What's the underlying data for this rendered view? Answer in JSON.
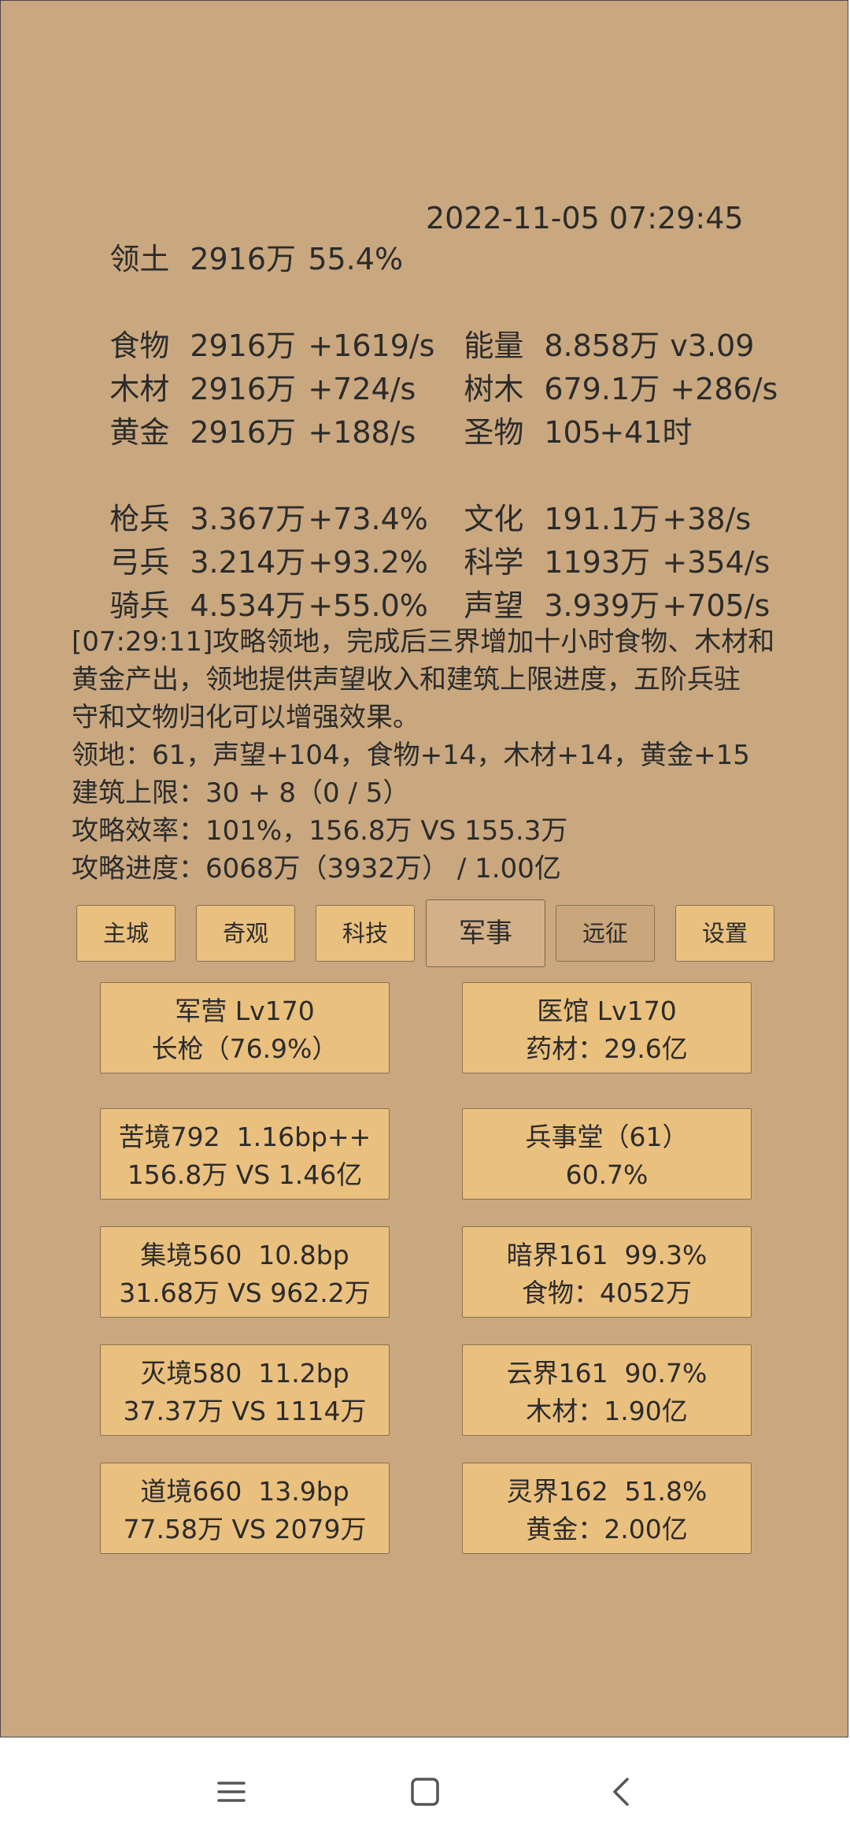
{
  "status": {
    "territory": {
      "label": "领土",
      "value": "2916万",
      "extra": "55.4%"
    },
    "datetime": "2022-11-05 07:29:45"
  },
  "resources_left": [
    {
      "label": "食物",
      "value": "2916万",
      "rate": "+1619/s"
    },
    {
      "label": "木材",
      "value": "2916万",
      "rate": "+724/s"
    },
    {
      "label": "黄金",
      "value": "2916万",
      "rate": "+188/s"
    }
  ],
  "resources_right": [
    {
      "label": "能量",
      "value": "8.858万",
      "rate": "v3.09"
    },
    {
      "label": "树木",
      "value": "679.1万",
      "rate": "+286/s"
    },
    {
      "label": "圣物",
      "value": "105",
      "rate": "+41时"
    }
  ],
  "troops_left": [
    {
      "label": "枪兵",
      "value": "3.367万",
      "rate": "+73.4%"
    },
    {
      "label": "弓兵",
      "value": "3.214万",
      "rate": "+93.2%"
    },
    {
      "label": "骑兵",
      "value": "4.534万",
      "rate": "+55.0%"
    }
  ],
  "troops_right": [
    {
      "label": "文化",
      "value": "191.1万",
      "rate": "+38/s"
    },
    {
      "label": "科学",
      "value": "1193万",
      "rate": "+354/s"
    },
    {
      "label": "声望",
      "value": "3.939万",
      "rate": "+705/s"
    }
  ],
  "log": {
    "lines": [
      "[07:29:11]攻略领地，完成后三界增加十小时食物、木材和",
      "黄金产出，领地提供声望收入和建筑上限进度，五阶兵驻",
      "守和文物归化可以增强效果。",
      "领地：61，声望+104，食物+14，木材+14，黄金+15",
      "建筑上限：30 + 8（0 / 5）",
      "攻略效率：101%，156.8万 VS 155.3万",
      "攻略进度：6068万（3932万） / 1.00亿"
    ]
  },
  "tabs": [
    {
      "label": "主城"
    },
    {
      "label": "奇观"
    },
    {
      "label": "科技"
    },
    {
      "label": "军事"
    },
    {
      "label": "远征"
    },
    {
      "label": "设置"
    }
  ],
  "cards": [
    {
      "line1": "军营 Lv170",
      "line2": "长枪（76.9%）"
    },
    {
      "line1": "医馆 Lv170",
      "line2": "药材：29.6亿"
    },
    {
      "line1": "苦境792  1.16bp++",
      "line2": "156.8万 VS 1.46亿"
    },
    {
      "line1": "兵事堂（61）",
      "line2": "60.7%"
    },
    {
      "line1": "集境560  10.8bp",
      "line2": "31.68万 VS 962.2万"
    },
    {
      "line1": "暗界161  99.3%",
      "line2": "食物：4052万"
    },
    {
      "line1": "灭境580  11.2bp",
      "line2": "37.37万 VS 1114万"
    },
    {
      "line1": "云界161  90.7%",
      "line2": "木材：1.90亿"
    },
    {
      "line1": "道境660  13.9bp",
      "line2": "77.58万 VS 2079万"
    },
    {
      "line1": "灵界162  51.8%",
      "line2": "黄金：2.00亿"
    }
  ],
  "navbar": {
    "icons": [
      "menu-icon",
      "home-icon",
      "back-icon"
    ]
  },
  "colors": {
    "background": "#c9a880",
    "button": "#eac07f",
    "text": "#2b2b2b"
  }
}
